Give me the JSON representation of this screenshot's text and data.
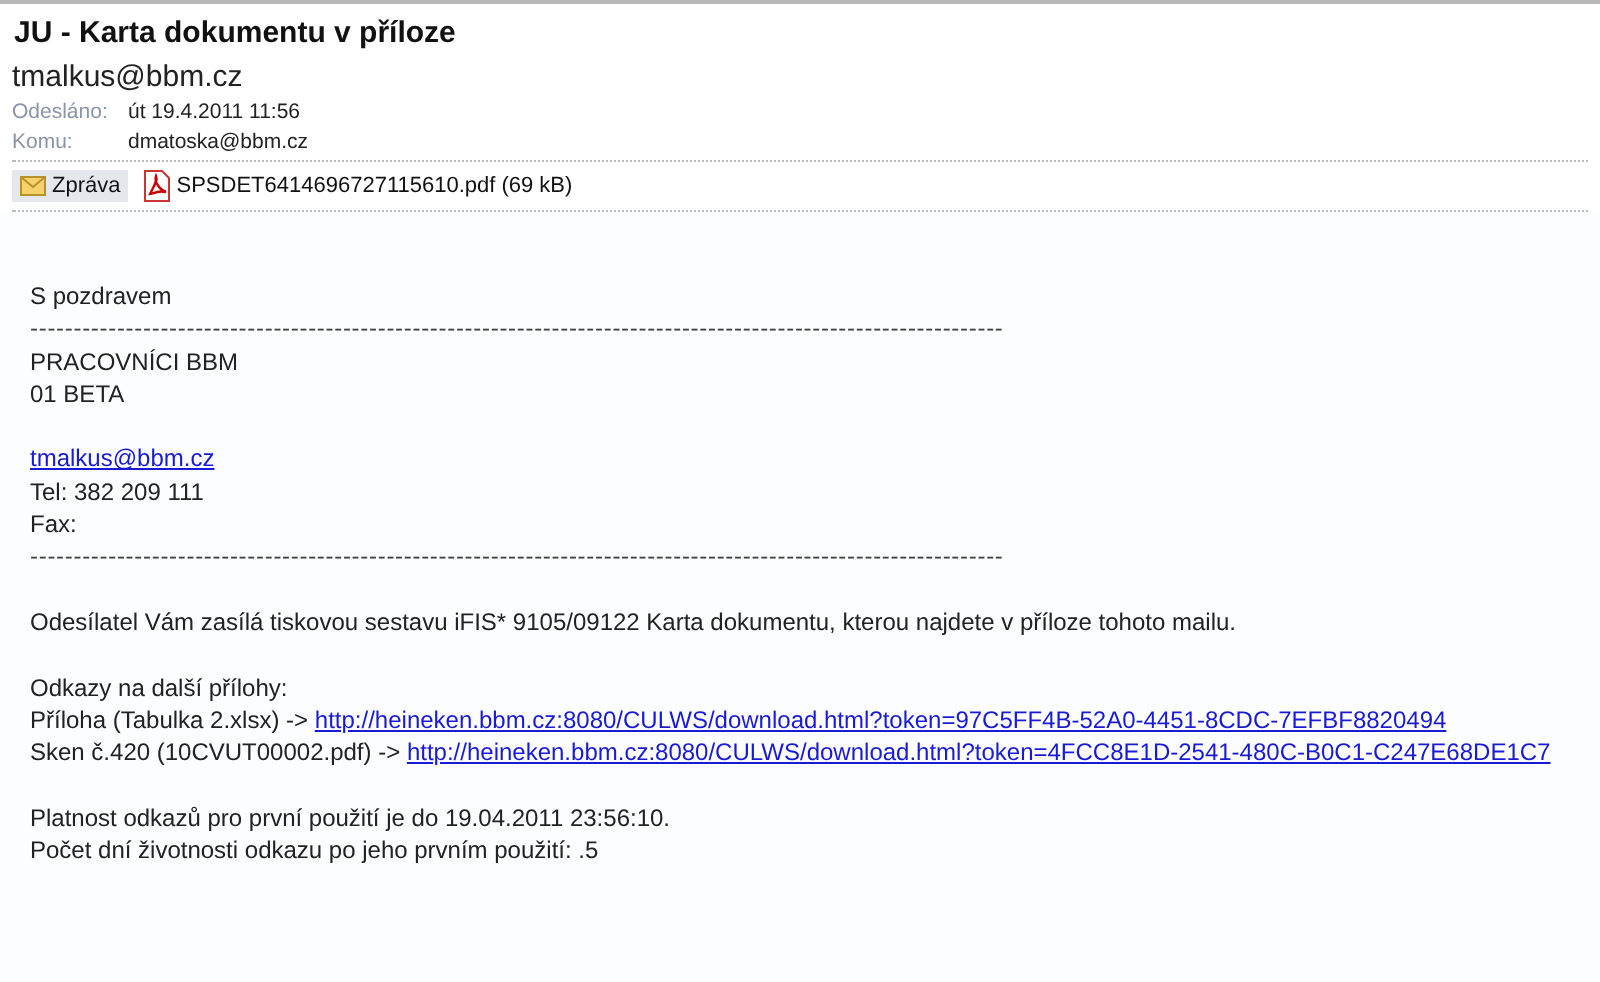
{
  "header": {
    "subject": "JU - Karta dokumentu v příloze",
    "from": "tmalkus@bbm.cz",
    "fields": [
      {
        "label": "Odesláno:",
        "value": "út 19.4.2011 11:56"
      },
      {
        "label": "Komu:",
        "value": "dmatoska@bbm.cz"
      }
    ],
    "attachments": [
      {
        "kind": "message",
        "label": "Zpráva",
        "selected": true
      },
      {
        "kind": "pdf",
        "label": "SPSDET6414696727115610.pdf (69 kB)",
        "selected": false
      }
    ]
  },
  "body": {
    "greeting": "S pozdravem",
    "separator": "----------------------------------------------------------------------------------------------------------------",
    "signature": [
      "PRACOVNÍCI BBM",
      "01 BETA"
    ],
    "contact": {
      "email": "tmalkus@bbm.cz",
      "tel": "Tel: 382 209 111",
      "fax": "Fax:"
    },
    "message": "Odesílatel Vám zasílá tiskovou sestavu iFIS* 9105/09122 Karta dokumentu, kterou najdete v příloze tohoto mailu.",
    "links_heading": "Odkazy na další přílohy:",
    "links": [
      {
        "label": "Příloha (Tabulka 2.xlsx) ->",
        "url": "http://heineken.bbm.cz:8080/CULWS/download.html?token=97C5FF4B-52A0-4451-8CDC-7EFBF8820494"
      },
      {
        "label": "Sken č.420 (10CVUT00002.pdf) ->",
        "url": "http://heineken.bbm.cz:8080/CULWS/download.html?token=4FCC8E1D-2541-480C-B0C1-C247E68DE1C7"
      }
    ],
    "validity": [
      "Platnost odkazů pro první použití je do 19.04.2011 23:56:10.",
      "Počet dní životnosti odkazu po jeho prvním použití: .5"
    ]
  }
}
